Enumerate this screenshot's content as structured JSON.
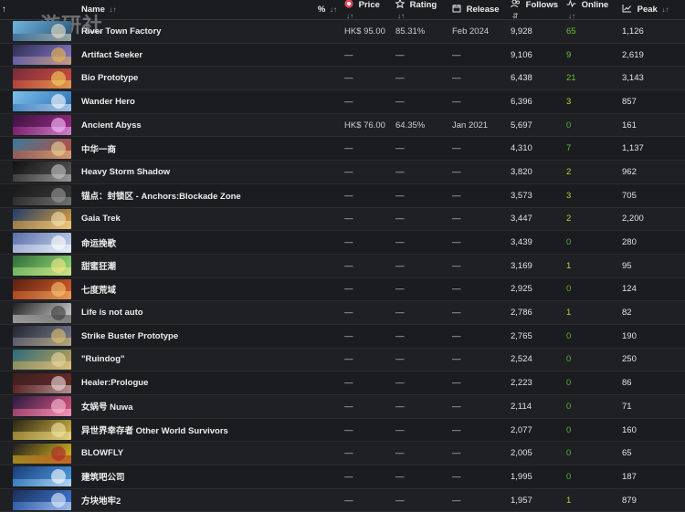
{
  "watermark": "游研社",
  "header": {
    "idx_label": "↑",
    "name": "Name",
    "pct": "%",
    "price": "Price",
    "rating": "Rating",
    "release": "Release",
    "follows": "Follows",
    "online": "Online",
    "peak": "Peak",
    "sort_glyph": "↓↑",
    "sort_active_glyph": "⇵"
  },
  "rows": [
    {
      "name": "River Town Factory",
      "price": "HK$ 95.00",
      "rating": "85.31%",
      "release": "Feb 2024",
      "follows": "9,928",
      "online": "65",
      "peak": "1,126",
      "thumb": [
        "#6fb6d9",
        "#2a4f7a",
        "#f0e8c8"
      ]
    },
    {
      "name": "Artifact Seeker",
      "price": "—",
      "rating": "—",
      "release": "—",
      "follows": "9,106",
      "online": "9",
      "peak": "2,619",
      "thumb": [
        "#2b2e52",
        "#8b7bd0",
        "#f0b84a"
      ]
    },
    {
      "name": "Bio Prototype",
      "price": "—",
      "rating": "—",
      "release": "—",
      "follows": "6,438",
      "online": "21",
      "peak": "3,143",
      "thumb": [
        "#7a2c3a",
        "#d1503f",
        "#f3d45b"
      ]
    },
    {
      "name": "Wander Hero",
      "price": "—",
      "rating": "—",
      "release": "—",
      "follows": "6,396",
      "online": "3",
      "peak": "857",
      "thumb": [
        "#7cc0e8",
        "#2d6fb8",
        "#ffffff"
      ]
    },
    {
      "name": "Ancient Abyss",
      "price": "HK$ 76.00",
      "rating": "64.35%",
      "release": "Jan 2021",
      "follows": "5,697",
      "online": "0",
      "peak": "161",
      "thumb": [
        "#3b1540",
        "#a12a88",
        "#f6c1ff"
      ]
    },
    {
      "name": "中华一商",
      "price": "—",
      "rating": "—",
      "release": "—",
      "follows": "4,310",
      "online": "7",
      "peak": "1,137",
      "thumb": [
        "#3a7a9a",
        "#c24a3a",
        "#e9d79a"
      ]
    },
    {
      "name": "Heavy Storm Shadow",
      "price": "—",
      "rating": "—",
      "release": "—",
      "follows": "3,820",
      "online": "2",
      "peak": "962",
      "thumb": [
        "#111111",
        "#5a5a5a",
        "#c8c8c8"
      ]
    },
    {
      "name": "锚点：封锁区 - Anchors:Blockade Zone",
      "price": "—",
      "rating": "—",
      "release": "—",
      "follows": "3,573",
      "online": "3",
      "peak": "705",
      "thumb": [
        "#1a1a1a",
        "#3b3b3b",
        "#999999"
      ]
    },
    {
      "name": "Gaia Trek",
      "price": "—",
      "rating": "—",
      "release": "—",
      "follows": "3,447",
      "online": "2",
      "peak": "2,200",
      "thumb": [
        "#1f3c6b",
        "#e3a23a",
        "#f5e3b0"
      ]
    },
    {
      "name": "命运挽歌",
      "price": "—",
      "rating": "—",
      "release": "—",
      "follows": "3,439",
      "online": "0",
      "peak": "280",
      "thumb": [
        "#5a6fa8",
        "#c9d6ee",
        "#ffffff"
      ]
    },
    {
      "name": "甜蜜狂潮",
      "price": "—",
      "rating": "—",
      "release": "—",
      "follows": "3,169",
      "online": "1",
      "peak": "95",
      "thumb": [
        "#2e6b3a",
        "#9be07a",
        "#f6e78a"
      ]
    },
    {
      "name": "七度荒域",
      "price": "—",
      "rating": "—",
      "release": "—",
      "follows": "2,925",
      "online": "0",
      "peak": "124",
      "thumb": [
        "#5b2012",
        "#d9622b",
        "#f8c47a"
      ]
    },
    {
      "name": "Life is not auto",
      "price": "—",
      "rating": "—",
      "release": "—",
      "follows": "2,786",
      "online": "1",
      "peak": "82",
      "thumb": [
        "#202020",
        "#d9d9d9",
        "#3a3a3a"
      ]
    },
    {
      "name": "Strike Buster Prototype",
      "price": "—",
      "rating": "—",
      "release": "—",
      "follows": "2,765",
      "online": "0",
      "peak": "190",
      "thumb": [
        "#23252f",
        "#7b7f95",
        "#e0c36a"
      ]
    },
    {
      "name": "\"Ruindog\"",
      "price": "—",
      "rating": "—",
      "release": "—",
      "follows": "2,524",
      "online": "0",
      "peak": "250",
      "thumb": [
        "#2b6a7d",
        "#c4a354",
        "#e8d8a0"
      ]
    },
    {
      "name": "Healer:Prologue",
      "price": "—",
      "rating": "—",
      "release": "—",
      "follows": "2,223",
      "online": "0",
      "peak": "86",
      "thumb": [
        "#3c1e1e",
        "#6d2b2b",
        "#f0e0e0"
      ]
    },
    {
      "name": "女娲号 Nuwa",
      "price": "—",
      "rating": "—",
      "release": "—",
      "follows": "2,114",
      "online": "0",
      "peak": "71",
      "thumb": [
        "#2a1a40",
        "#e05a86",
        "#ffc0d6"
      ]
    },
    {
      "name": "异世界幸存者 Other World Survivors",
      "price": "—",
      "rating": "—",
      "release": "—",
      "follows": "2,077",
      "online": "0",
      "peak": "160",
      "thumb": [
        "#2a2512",
        "#d6b94a",
        "#f2e6a8"
      ]
    },
    {
      "name": "BLOWFLY",
      "price": "—",
      "rating": "—",
      "release": "—",
      "follows": "2,005",
      "online": "0",
      "peak": "65",
      "thumb": [
        "#1e1e1e",
        "#e3c01e",
        "#b21f2a"
      ]
    },
    {
      "name": "建筑吧公司",
      "price": "—",
      "rating": "—",
      "release": "—",
      "follows": "1,995",
      "online": "0",
      "peak": "187",
      "thumb": [
        "#1a3d7a",
        "#4fa1e3",
        "#ffffff"
      ]
    },
    {
      "name": "方块地牢2",
      "price": "—",
      "rating": "—",
      "release": "—",
      "follows": "1,957",
      "online": "1",
      "peak": "879",
      "thumb": [
        "#1c2e5c",
        "#3e7bd6",
        "#e9f0ff"
      ]
    }
  ],
  "colors": {
    "background": "#1b1c1f",
    "online_positive": "#6fbf3b",
    "online_zero": "#5fae3a",
    "price_icon": "#e04a5a"
  },
  "icons": {
    "price": "price-tag-icon",
    "rating": "star-icon",
    "release": "calendar-icon",
    "follows": "users-icon",
    "online": "pulse-icon",
    "peak": "chart-up-icon"
  }
}
